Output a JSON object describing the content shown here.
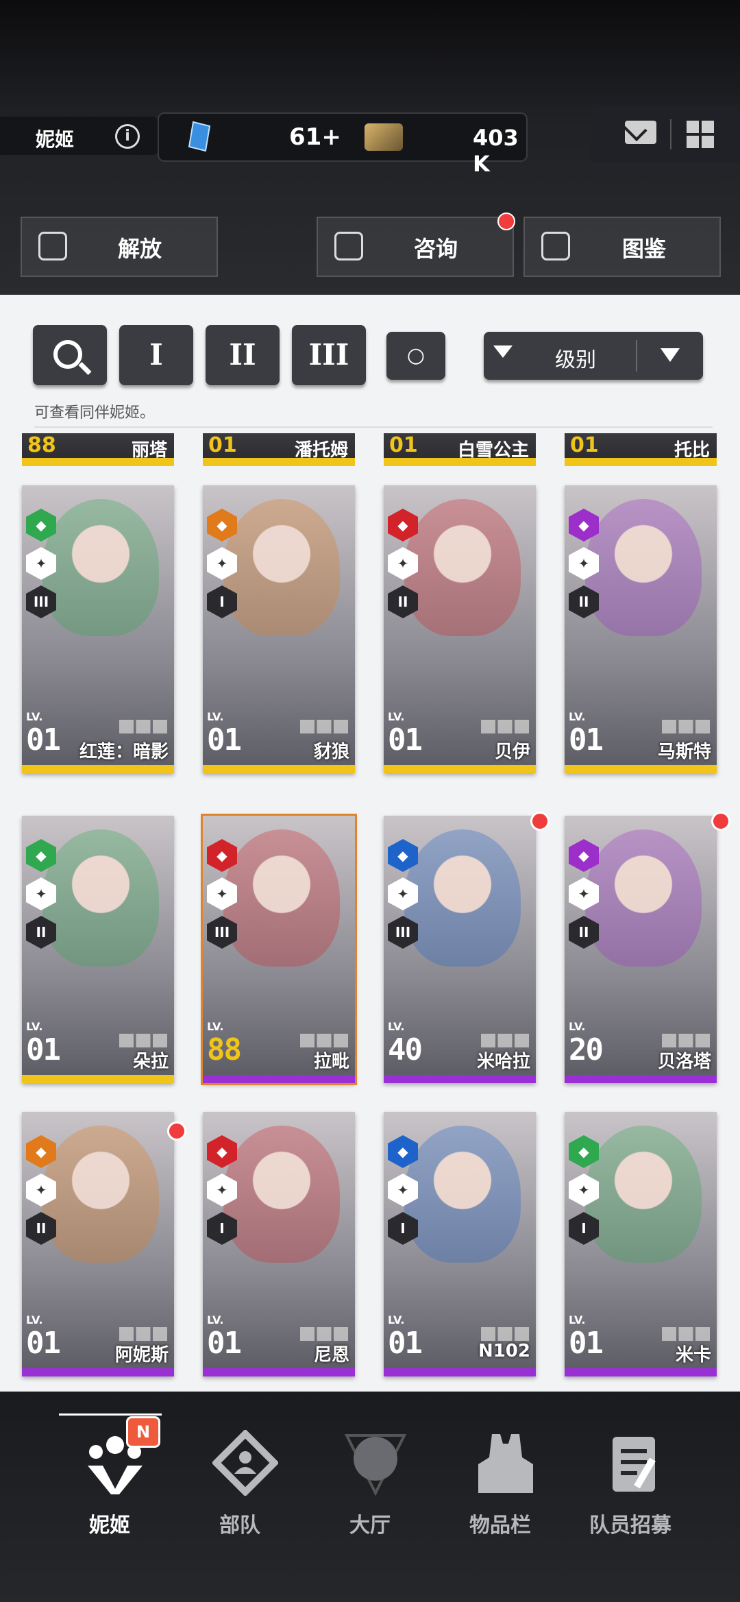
{
  "header": {
    "name": "妮姬",
    "gems": "61",
    "gems_plus": "+",
    "credits": "403 K"
  },
  "actions": {
    "release": "解放",
    "consult": "咨询",
    "archive": "图鉴"
  },
  "filters": {
    "tier1": "I",
    "tier2": "II",
    "tier3": "III",
    "sort_label": "级别",
    "hint": "可查看同伴妮姬。"
  },
  "partial_row": [
    {
      "level": "88",
      "name": "丽塔"
    },
    {
      "level": "01",
      "name": "潘托姆"
    },
    {
      "level": "01",
      "name": "白雪公主"
    },
    {
      "level": "01",
      "name": "托比"
    }
  ],
  "cards": [
    {
      "name": "红莲：暗影",
      "lv_label": "LV.",
      "level": "01",
      "element": "wind",
      "element_color": "#2fa84f",
      "tier": "III",
      "bar": "#f0c419"
    },
    {
      "name": "豺狼",
      "lv_label": "LV.",
      "level": "01",
      "element": "iron",
      "element_color": "#e07a1a",
      "tier": "I",
      "bar": "#f0c419"
    },
    {
      "name": "贝伊",
      "lv_label": "LV.",
      "level": "01",
      "element": "fire",
      "element_color": "#d2232a",
      "tier": "II",
      "bar": "#f0c419"
    },
    {
      "name": "马斯特",
      "lv_label": "LV.",
      "level": "01",
      "element": "electric",
      "element_color": "#9c2fc9",
      "tier": "II",
      "bar": "#f0c419"
    },
    {
      "name": "朵拉",
      "lv_label": "LV.",
      "level": "01",
      "element": "wind",
      "element_color": "#2fa84f",
      "tier": "II",
      "bar": "#f0c419"
    },
    {
      "name": "拉毗",
      "lv_label": "LV.",
      "level": "88",
      "element": "fire",
      "element_color": "#d2232a",
      "tier": "III",
      "bar": "#9b2fd6"
    },
    {
      "name": "米哈拉",
      "lv_label": "LV.",
      "level": "40",
      "element": "water",
      "element_color": "#1e63c9",
      "tier": "III",
      "bar": "#9b2fd6"
    },
    {
      "name": "贝洛塔",
      "lv_label": "LV.",
      "level": "20",
      "element": "electric",
      "element_color": "#9c2fc9",
      "tier": "II",
      "bar": "#9b2fd6"
    },
    {
      "name": "阿妮斯",
      "lv_label": "LV.",
      "level": "01",
      "element": "iron",
      "element_color": "#e07a1a",
      "tier": "II",
      "bar": "#9b2fd6"
    },
    {
      "name": "尼恩",
      "lv_label": "LV.",
      "level": "01",
      "element": "fire",
      "element_color": "#d2232a",
      "tier": "I",
      "bar": "#9b2fd6"
    },
    {
      "name": "N102",
      "lv_label": "LV.",
      "level": "01",
      "element": "water",
      "element_color": "#1e63c9",
      "tier": "I",
      "bar": "#9b2fd6"
    },
    {
      "name": "米卡",
      "lv_label": "LV.",
      "level": "01",
      "element": "wind",
      "element_color": "#2fa84f",
      "tier": "I",
      "bar": "#9b2fd6"
    }
  ],
  "nav": {
    "nikke": "妮姬",
    "nikke_badge": "N",
    "squad": "部队",
    "lobby": "大厅",
    "inventory": "物品栏",
    "recruit": "队员招募"
  }
}
